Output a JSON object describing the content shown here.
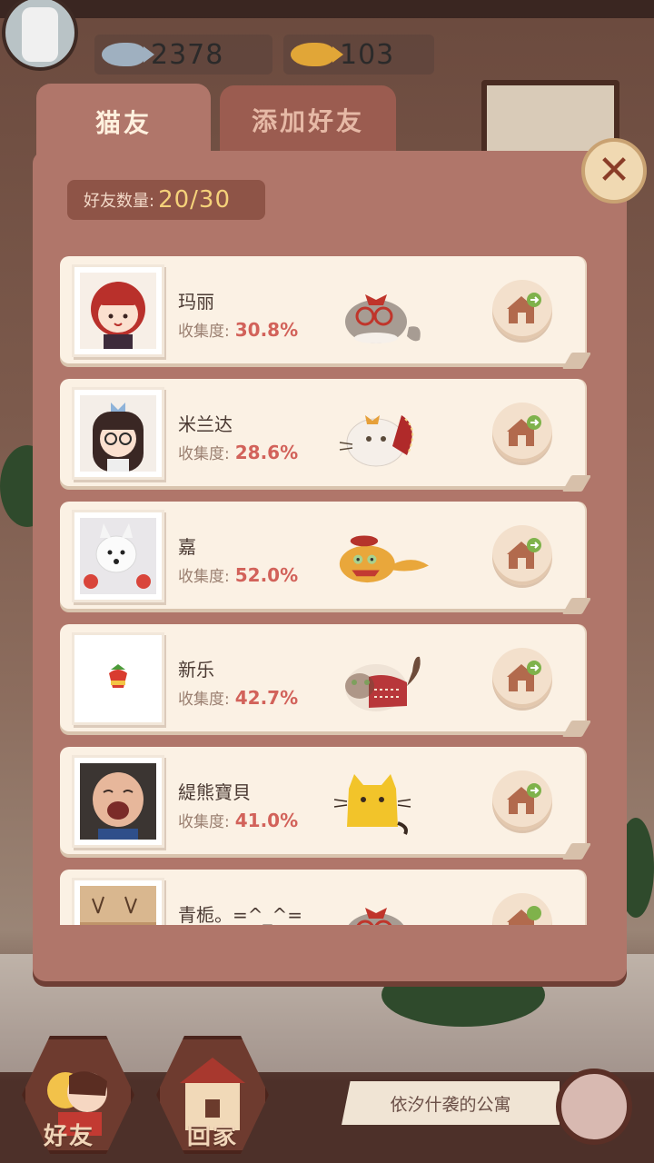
{
  "currency": [
    {
      "icon": "silver-fish-icon",
      "value": "2378",
      "color": "#9fb0c0"
    },
    {
      "icon": "gold-fish-icon",
      "value": "103",
      "color": "#e1a637"
    }
  ],
  "tabs": [
    {
      "label": "猫友",
      "active": true
    },
    {
      "label": "添加好友",
      "active": false
    }
  ],
  "friend_count": {
    "label": "好友数量:",
    "value": "20/30"
  },
  "collect_label": "收集度:",
  "friends": [
    {
      "name": "玛丽",
      "collect": "30.8%",
      "avatar": "red-hair-maid-avatar",
      "pet": "gray-cat-with-bow-and-glasses"
    },
    {
      "name": "米兰达",
      "collect": "28.6%",
      "avatar": "girl-with-glasses-avatar",
      "pet": "white-cat-with-bonnet"
    },
    {
      "name": "嘉",
      "collect": "52.0%",
      "avatar": "white-puppy-photo-avatar",
      "pet": "orange-fluffy-cat-with-beret"
    },
    {
      "name": "新乐",
      "collect": "42.7%",
      "avatar": "strawberry-icon-avatar",
      "pet": "siamese-cat-in-sweater"
    },
    {
      "name": "緹熊寶貝",
      "collect": "41.0%",
      "avatar": "laughing-baby-photo-avatar",
      "pet": "yellow-cat"
    },
    {
      "name": "青栀。=^_^=",
      "collect": "",
      "avatar": "deer-photo-avatar",
      "pet": "gray-cat-with-bow-and-glasses"
    }
  ],
  "nav": [
    {
      "label": "好友",
      "icon": "friends-icon"
    },
    {
      "label": "回家",
      "icon": "home-house-icon"
    }
  ],
  "apartment_label": "依汐什袭的公寓",
  "colors": {
    "panel": "#b0766a",
    "card": "#fbf1e4",
    "percent": "#d2625a",
    "tab_text": "#fff1df"
  }
}
